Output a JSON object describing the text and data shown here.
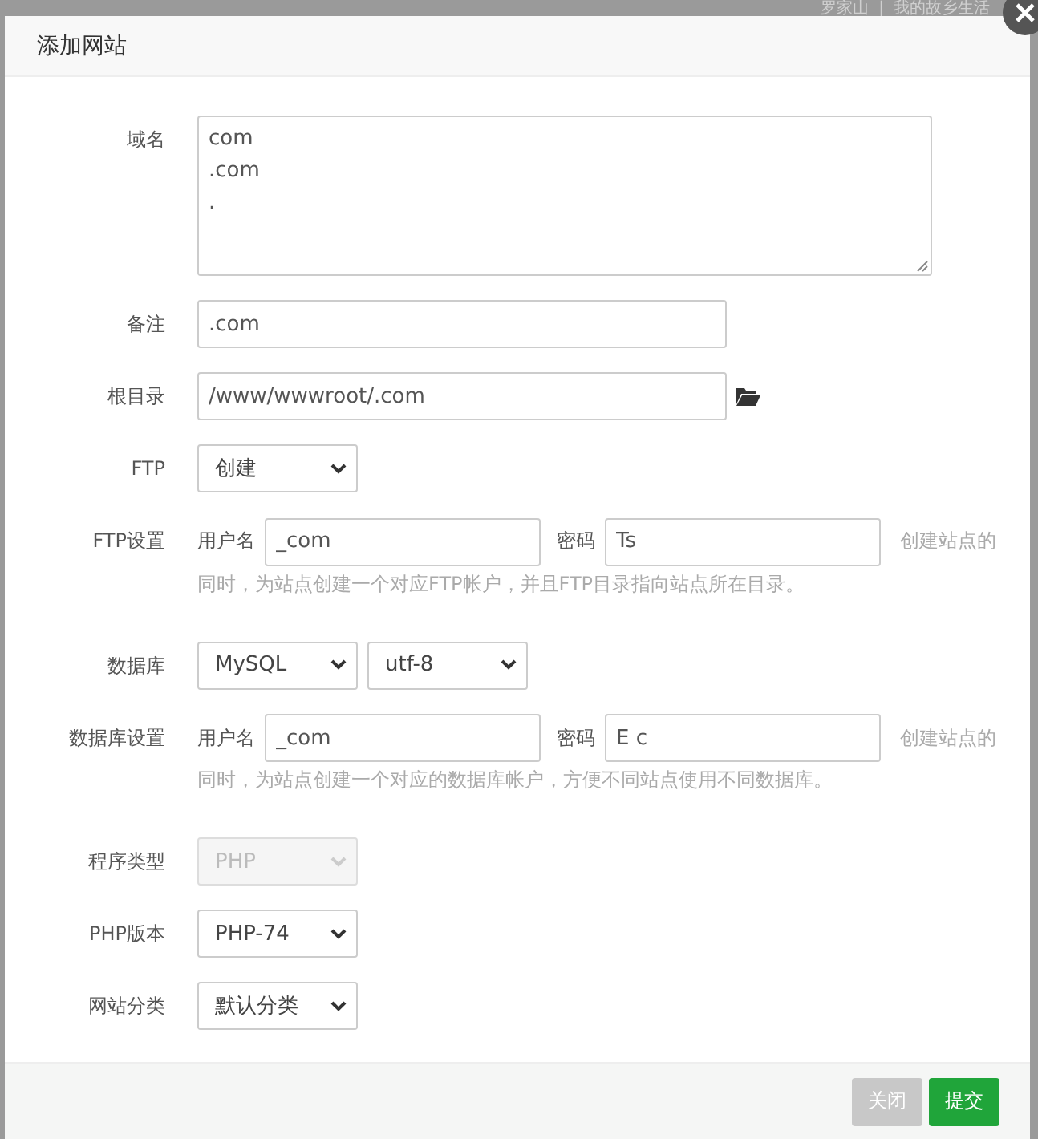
{
  "background": {
    "links": [
      "罗家山",
      "我的故乡生活"
    ],
    "separator": "|"
  },
  "dialog": {
    "title": "添加网站",
    "domain": {
      "label": "域名",
      "lines": [
        "com",
        ".com",
        "."
      ]
    },
    "remark": {
      "label": "备注",
      "value": ".com"
    },
    "root": {
      "label": "根目录",
      "value": "/www/wwwroot/.com"
    },
    "ftp": {
      "label": "FTP",
      "value": "创建"
    },
    "ftp_settings": {
      "label": "FTP设置",
      "user_label": "用户名",
      "user": "_com",
      "pass_label": "密码",
      "pass": "Ts",
      "hint": [
        "创建站点的",
        "同时，为站点创建一个对应FTP帐户，并且FTP目录指向站点所在目录。"
      ]
    },
    "database": {
      "label": "数据库",
      "type": "MySQL",
      "charset": "utf-8"
    },
    "db_settings": {
      "label": "数据库设置",
      "user_label": "用户名",
      "user": "_com",
      "pass_label": "密码",
      "pass": "E c",
      "hint": [
        "创建站点的",
        "同时，为站点创建一个对应的数据库帐户，方便不同站点使用不同数据库。"
      ]
    },
    "program_type": {
      "label": "程序类型",
      "value": "PHP",
      "disabled": true
    },
    "php_version": {
      "label": "PHP版本",
      "value": "PHP-74",
      "disabled": false
    },
    "category": {
      "label": "网站分类",
      "value": "默认分类",
      "disabled": false
    },
    "buttons": [
      {
        "label": "关闭",
        "kind": "secondary"
      },
      {
        "label": "提交",
        "kind": "primary"
      }
    ]
  }
}
